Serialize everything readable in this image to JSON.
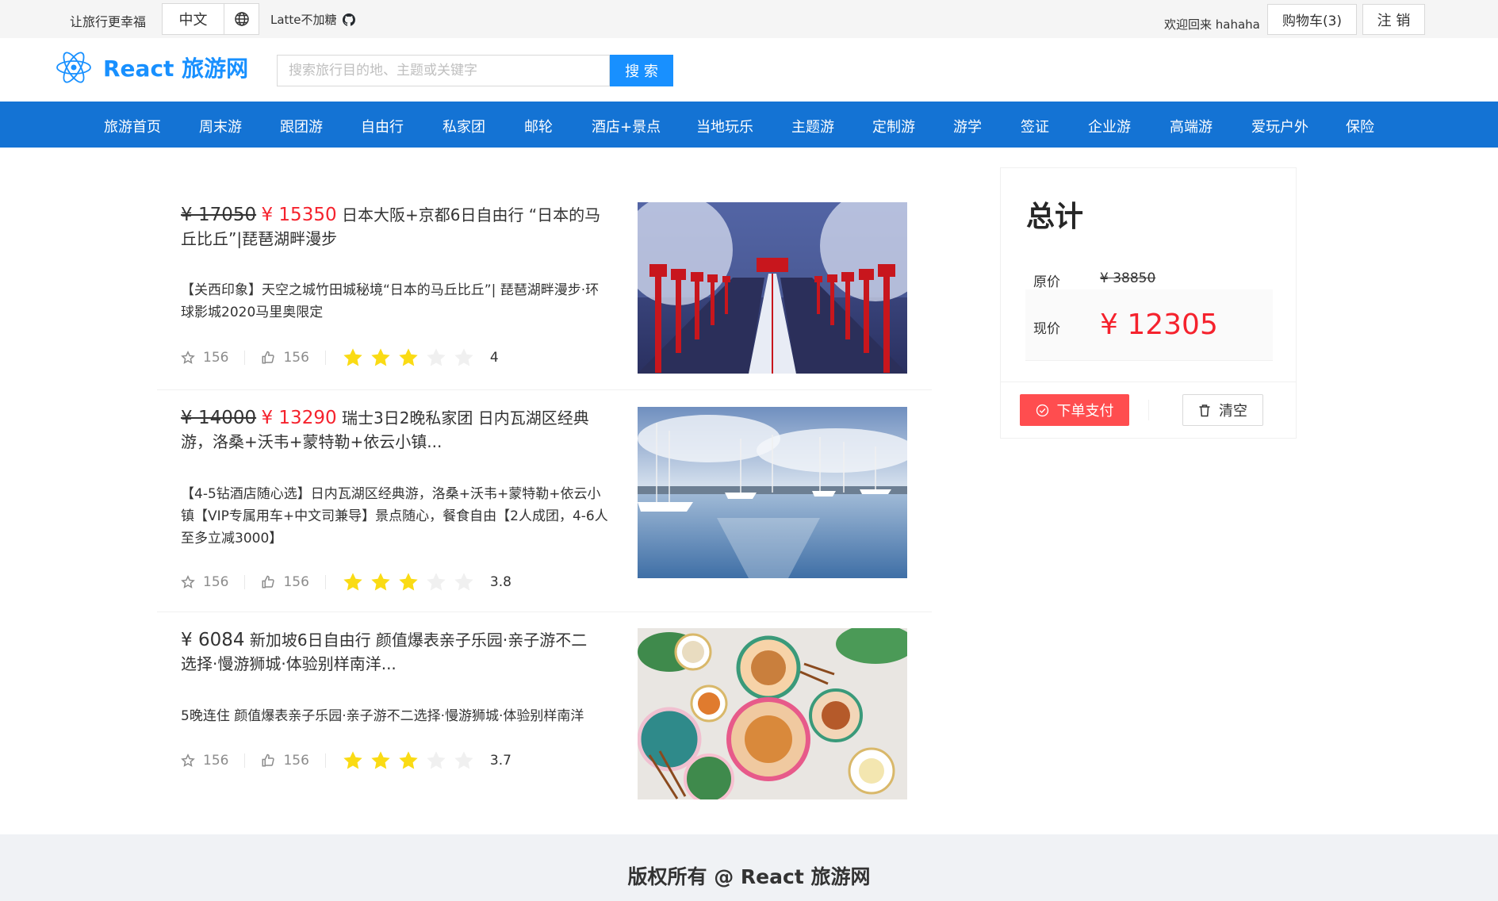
{
  "topbar": {
    "slogan": "让旅行更幸福",
    "language": "中文",
    "author": "Latte不加糖",
    "welcome": "欢迎回来 hahaha",
    "cart_label": "购物车(3)",
    "logout_label": "注 销"
  },
  "header": {
    "logo_title": "React 旅游网",
    "search_placeholder": "搜索旅行目的地、主题或关键字",
    "search_button": "搜 索"
  },
  "nav": [
    "旅游首页",
    "周末游",
    "跟团游",
    "自由行",
    "私家团",
    "邮轮",
    "酒店+景点",
    "当地玩乐",
    "主题游",
    "定制游",
    "游学",
    "签证",
    "企业游",
    "高端游",
    "爱玩户外",
    "保险"
  ],
  "products": [
    {
      "original_price": "¥ 17050",
      "price": "¥ 15350",
      "title": "日本大阪+京都6日自由行 “日本的马丘比丘”|琵琶湖畔漫步",
      "description": "【关西印象】天空之城竹田城秘境“日本的马丘比丘”| 琵琶湖畔漫步·环球影城2020马里奥限定",
      "favorites": "156",
      "likes": "156",
      "rating": "4",
      "image": "snow-red-lanterns-stairs"
    },
    {
      "original_price": "¥ 14000",
      "price": "¥ 13290",
      "title": "瑞士3日2晚私家团 日内瓦湖区经典游，洛桑+沃韦+蒙特勒+依云小镇...",
      "description": "【4-5钻酒店随心选】日内瓦湖区经典游，洛桑+沃韦+蒙特勒+依云小镇【VIP专属用车+中文司兼导】景点随心，餐食自由【2人成团，4-6人至多立减3000】",
      "favorites": "156",
      "likes": "156",
      "rating": "3.8",
      "image": "lake-harbor-sailboats"
    },
    {
      "original_price": "",
      "price": "¥ 6084",
      "title": "新加坡6日自由行 颜值爆表亲子乐园·亲子游不二选择·慢游狮城·体验别样南洋...",
      "description": "5晚连住 颜值爆表亲子乐园·亲子游不二选择·慢游狮城·体验别样南洋",
      "favorites": "156",
      "likes": "156",
      "rating": "3.7",
      "image": "singapore-food-table"
    }
  ],
  "summary": {
    "title": "总计",
    "original_label": "原价",
    "original_value": "¥ 38850",
    "current_label": "现价",
    "current_value": "¥ 12305",
    "pay_button": "下单支付",
    "clear_button": "清空"
  },
  "footer": {
    "copyright": "版权所有 @ React 旅游网"
  },
  "colors": {
    "brand": "#1890ff",
    "nav_bg": "#1473d4",
    "price_red": "#f5222d",
    "pay_red": "#ff4d4f",
    "star": "#fadb14"
  }
}
